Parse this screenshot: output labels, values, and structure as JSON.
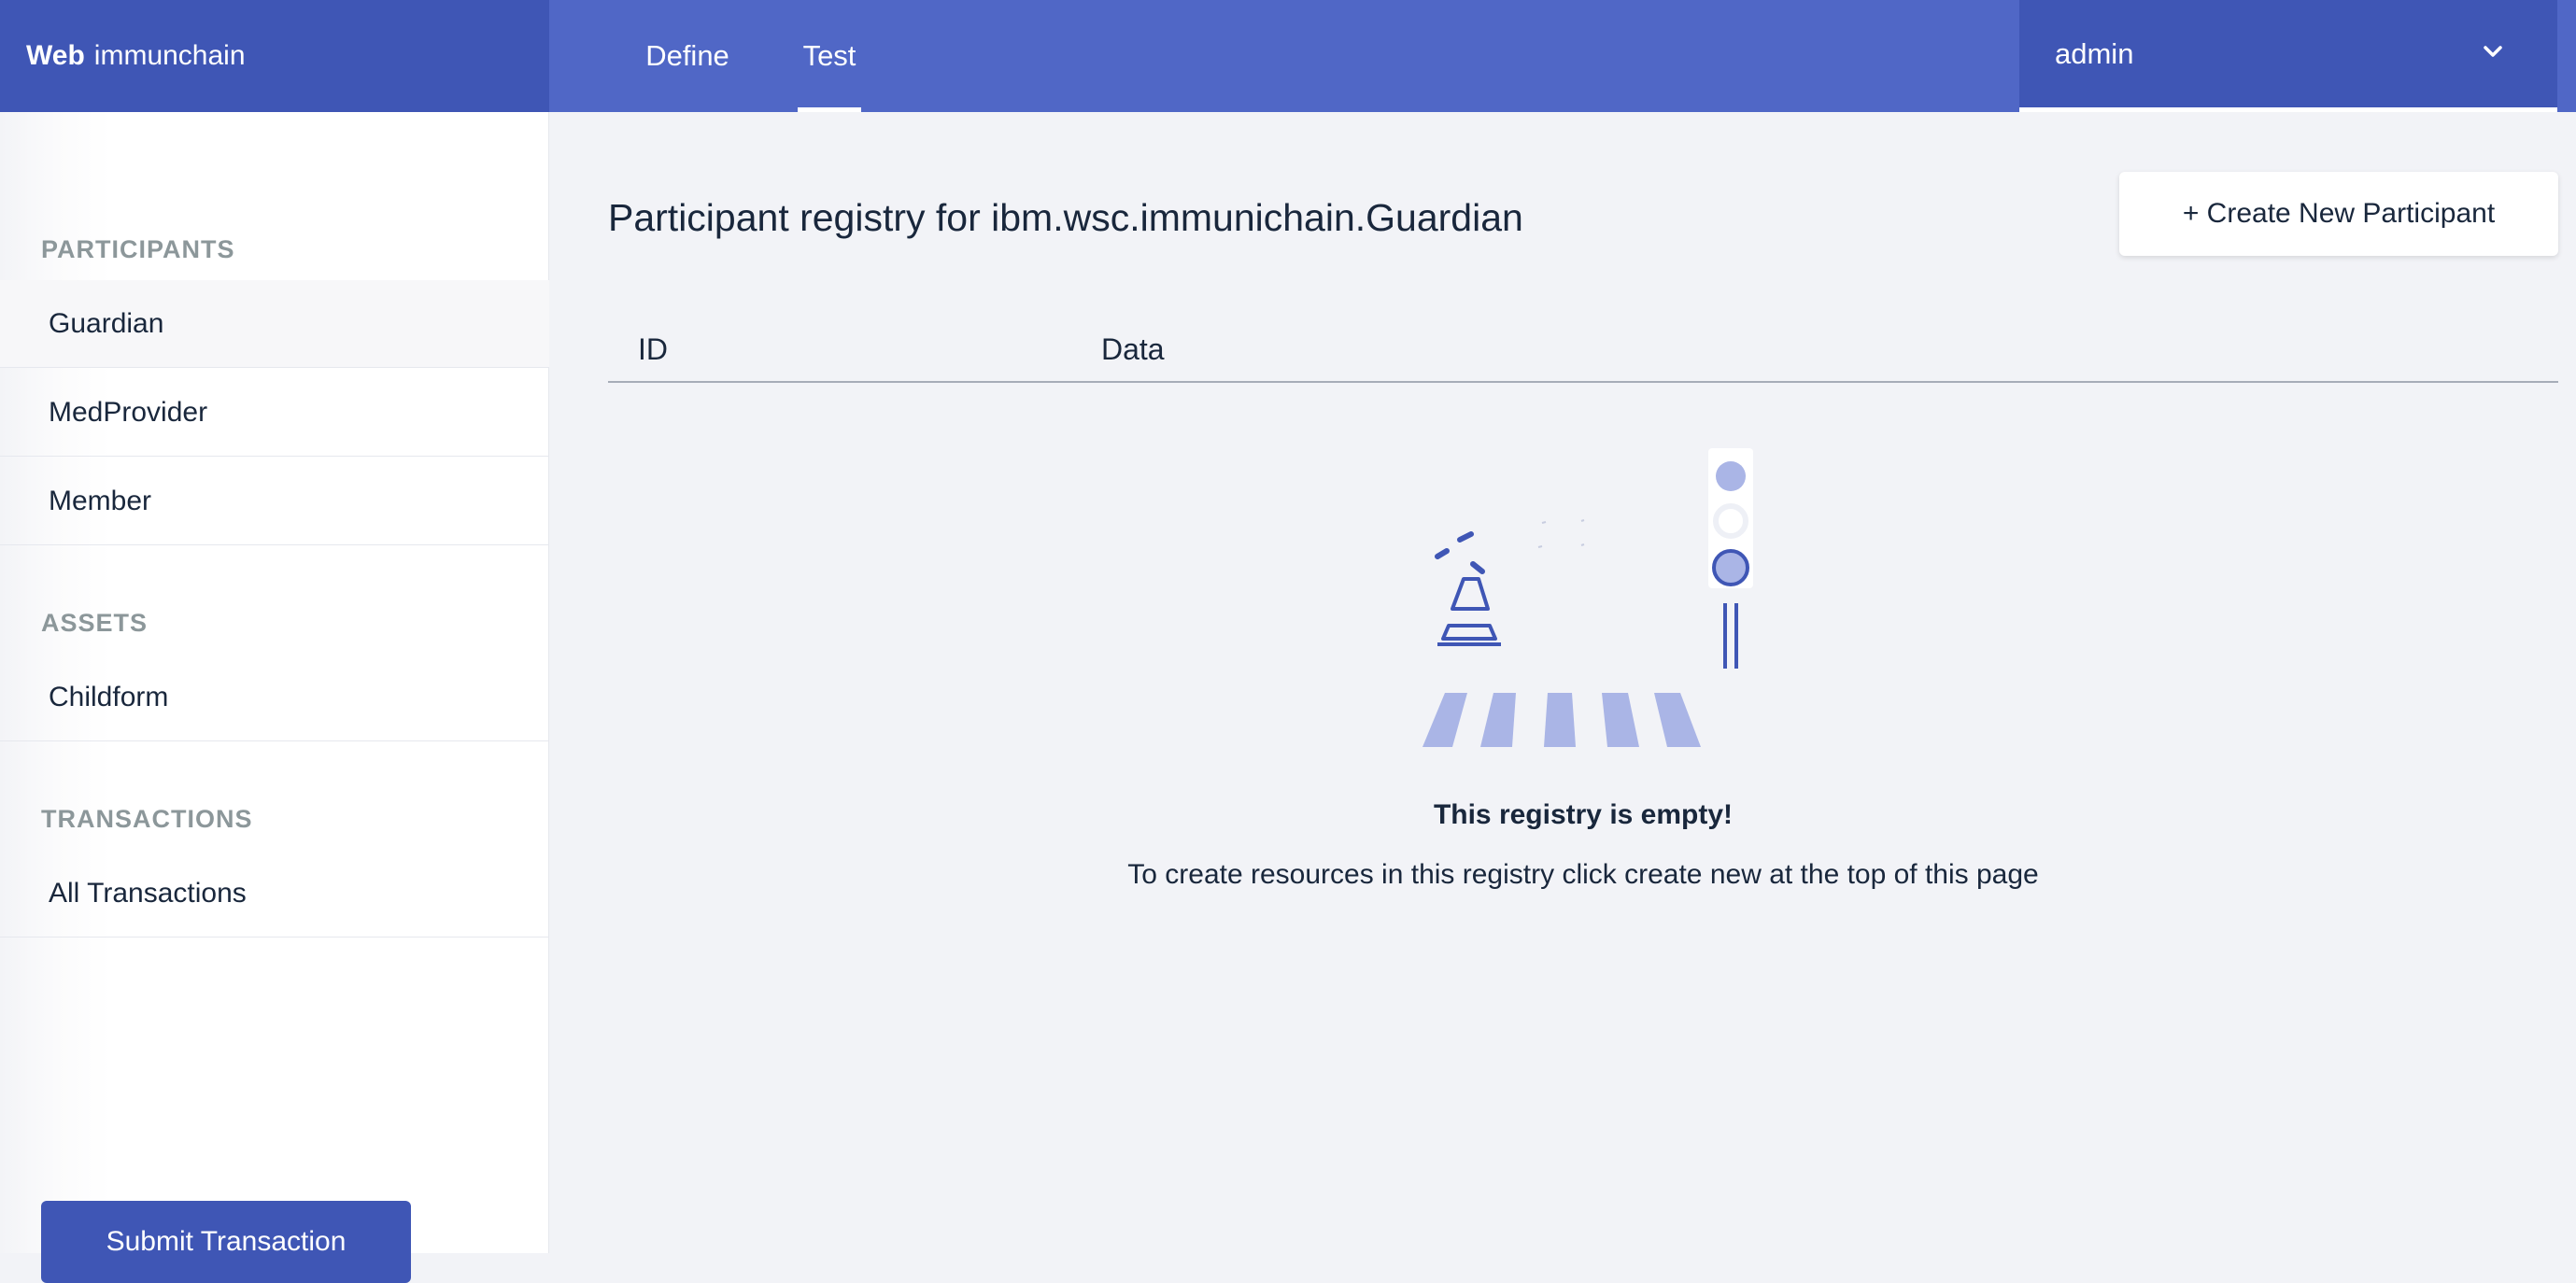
{
  "app": {
    "brand_bold": "Web",
    "brand_name": "immunchain"
  },
  "nav": {
    "tabs": [
      {
        "label": "Define",
        "active": false
      },
      {
        "label": "Test",
        "active": true
      }
    ]
  },
  "user_menu": {
    "username": "admin",
    "icon": "chevron-down-icon"
  },
  "sidebar": {
    "sections": [
      {
        "heading": "PARTICIPANTS",
        "items": [
          "Guardian",
          "MedProvider",
          "Member"
        ]
      },
      {
        "heading": "ASSETS",
        "items": [
          "Childform"
        ]
      },
      {
        "heading": "TRANSACTIONS",
        "items": [
          "All Transactions"
        ]
      }
    ],
    "selected_item": "Guardian",
    "submit_label": "Submit Transaction"
  },
  "main": {
    "title": "Participant registry for ibm.wsc.immunichain.Guardian",
    "create_label": "+ Create New Participant",
    "columns": [
      "ID",
      "Data"
    ],
    "empty_title": "This registry is empty!",
    "empty_message": "To create resources in this registry click create new at the top of this page"
  },
  "colors": {
    "accent": "#3f56b5",
    "topbar": "#5067c6",
    "illustration_light": "#aab5e6",
    "background": "#f2f3f7"
  }
}
